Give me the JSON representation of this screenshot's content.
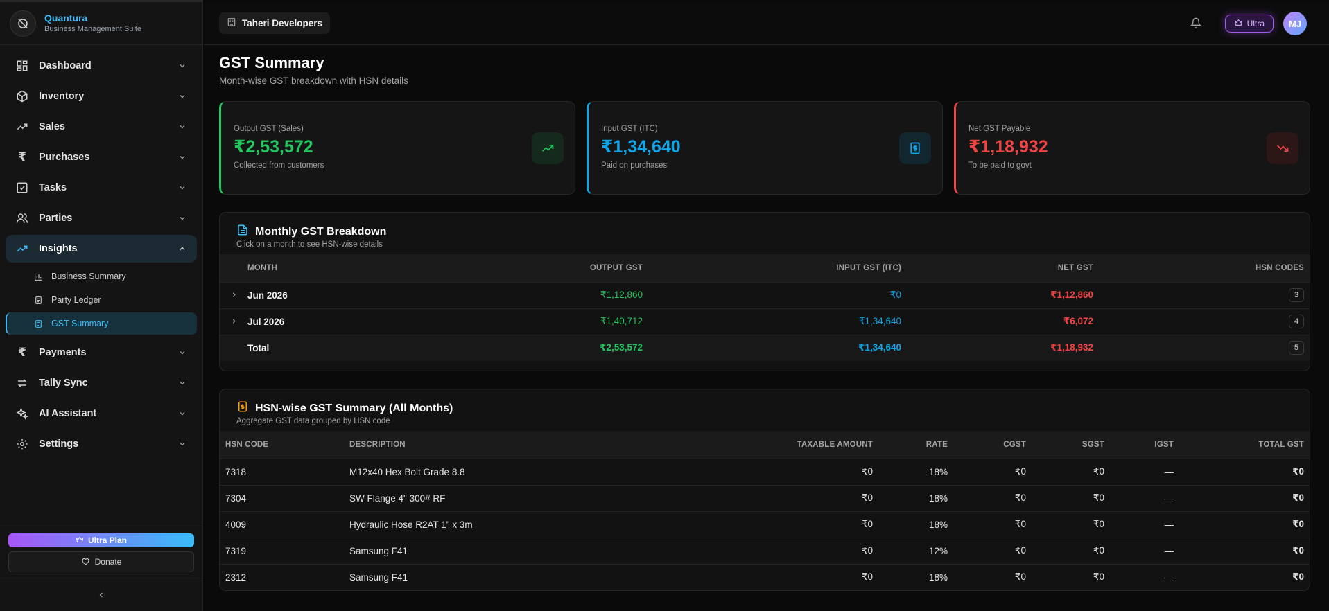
{
  "brand": {
    "name": "Quantura",
    "subtitle": "Business Management Suite"
  },
  "nav": {
    "items": [
      {
        "label": "Dashboard",
        "icon": "dashboard-icon"
      },
      {
        "label": "Inventory",
        "icon": "box-icon"
      },
      {
        "label": "Sales",
        "icon": "trending-up-icon"
      },
      {
        "label": "Purchases",
        "icon": "rupee-icon"
      },
      {
        "label": "Tasks",
        "icon": "checklist-icon"
      },
      {
        "label": "Parties",
        "icon": "users-icon"
      },
      {
        "label": "Insights",
        "icon": "trending-up-icon"
      },
      {
        "label": "Payments",
        "icon": "rupee-icon"
      },
      {
        "label": "Tally Sync",
        "icon": "sync-icon"
      },
      {
        "label": "AI Assistant",
        "icon": "sparkles-icon"
      },
      {
        "label": "Settings",
        "icon": "gear-icon"
      }
    ],
    "insights_sub": [
      {
        "label": "Business Summary"
      },
      {
        "label": "Party Ledger"
      },
      {
        "label": "GST Summary"
      }
    ]
  },
  "sidebar_bottom": {
    "ultra_plan": "Ultra Plan",
    "donate": "Donate"
  },
  "topbar": {
    "company": "Taheri Developers",
    "plan_badge": "Ultra",
    "avatar_initials": "MJ"
  },
  "page": {
    "title": "GST Summary",
    "subtitle": "Month-wise GST breakdown with HSN details"
  },
  "cards": [
    {
      "label": "Output GST (Sales)",
      "value": "₹2,53,572",
      "note": "Collected from customers",
      "color": "#22c55e"
    },
    {
      "label": "Input GST (ITC)",
      "value": "₹1,34,640",
      "note": "Paid on purchases",
      "color": "#0ea5e9"
    },
    {
      "label": "Net GST Payable",
      "value": "₹1,18,932",
      "note": "To be paid to govt",
      "color": "#ef4444"
    }
  ],
  "monthly": {
    "title": "Monthly GST Breakdown",
    "subtitle": "Click on a month to see HSN-wise details",
    "headers": [
      "MONTH",
      "OUTPUT GST",
      "INPUT GST (ITC)",
      "NET GST",
      "HSN CODES"
    ],
    "rows": [
      {
        "month": "Jun 2026",
        "output": "₹1,12,860",
        "input": "₹0",
        "net": "₹1,12,860",
        "hsn": "3"
      },
      {
        "month": "Jul 2026",
        "output": "₹1,40,712",
        "input": "₹1,34,640",
        "net": "₹6,072",
        "hsn": "4"
      }
    ],
    "total": {
      "label": "Total",
      "output": "₹2,53,572",
      "input": "₹1,34,640",
      "net": "₹1,18,932",
      "hsn": "5"
    }
  },
  "hsn": {
    "title": "HSN-wise GST Summary (All Months)",
    "subtitle": "Aggregate GST data grouped by HSN code",
    "headers": [
      "HSN CODE",
      "DESCRIPTION",
      "TAXABLE AMOUNT",
      "RATE",
      "CGST",
      "SGST",
      "IGST",
      "TOTAL GST"
    ],
    "rows": [
      {
        "code": "7318",
        "desc": "M12x40 Hex Bolt Grade 8.8",
        "taxable": "₹0",
        "rate": "18%",
        "cgst": "₹0",
        "sgst": "₹0",
        "igst": "—",
        "total": "₹0"
      },
      {
        "code": "7304",
        "desc": "SW Flange 4\" 300# RF",
        "taxable": "₹0",
        "rate": "18%",
        "cgst": "₹0",
        "sgst": "₹0",
        "igst": "—",
        "total": "₹0"
      },
      {
        "code": "4009",
        "desc": "Hydraulic Hose R2AT 1\" x 3m",
        "taxable": "₹0",
        "rate": "18%",
        "cgst": "₹0",
        "sgst": "₹0",
        "igst": "—",
        "total": "₹0"
      },
      {
        "code": "7319",
        "desc": "Samsung F41",
        "taxable": "₹0",
        "rate": "12%",
        "cgst": "₹0",
        "sgst": "₹0",
        "igst": "—",
        "total": "₹0"
      },
      {
        "code": "2312",
        "desc": "Samsung F41",
        "taxable": "₹0",
        "rate": "18%",
        "cgst": "₹0",
        "sgst": "₹0",
        "igst": "—",
        "total": "₹0"
      }
    ]
  },
  "colors": {
    "accent": "#38bdf8",
    "green": "#22c55e",
    "blue": "#0ea5e9",
    "red": "#ef4444",
    "purple": "#a855f7"
  }
}
